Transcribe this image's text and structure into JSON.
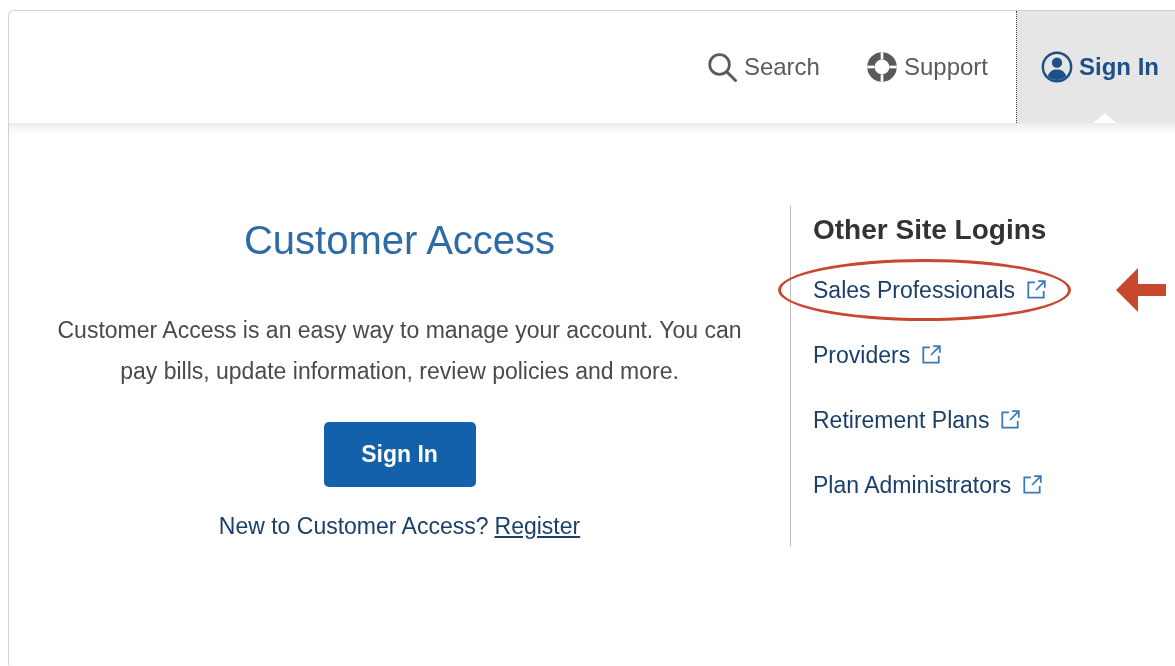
{
  "nav": [
    {
      "kind": "search",
      "label": "Search",
      "selected": false
    },
    {
      "kind": "support",
      "label": "Support",
      "selected": false
    },
    {
      "kind": "account",
      "label": "Sign In",
      "selected": true
    }
  ],
  "customer_access": {
    "title": "Customer Access",
    "description": "Customer Access is an easy way to manage your account. You can pay bills, update information, review policies and more.",
    "button": "Sign In",
    "register_prompt": "New to Customer Access?",
    "register_link": "Register"
  },
  "other_logins": {
    "heading": "Other Site Logins",
    "links": [
      {
        "label": "Sales Professionals",
        "highlighted": true
      },
      {
        "label": "Providers",
        "highlighted": false
      },
      {
        "label": "Retirement Plans",
        "highlighted": false
      },
      {
        "label": "Plan Administrators",
        "highlighted": false
      }
    ]
  }
}
